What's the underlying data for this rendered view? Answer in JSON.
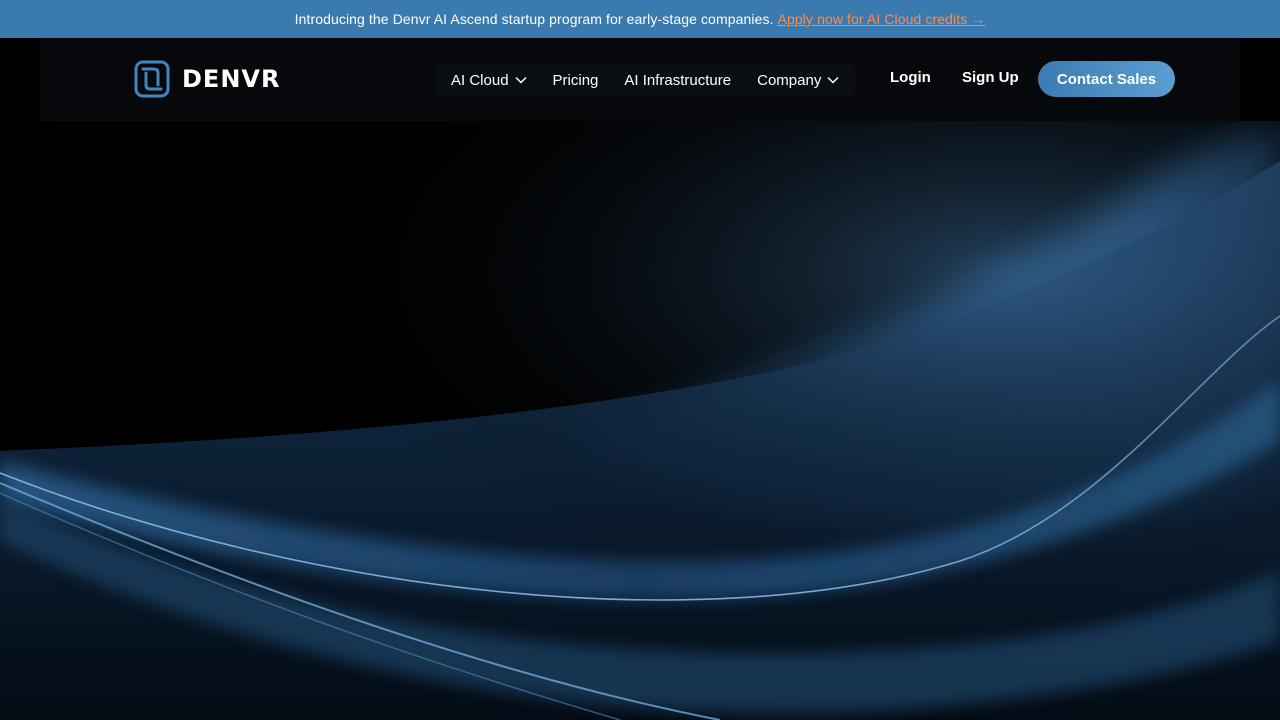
{
  "announcement": {
    "text": "Introducing the Denvr AI Ascend startup program for early-stage companies.",
    "link_label": "Apply now for AI Cloud credits →"
  },
  "brand": {
    "name": "DENVR"
  },
  "nav": {
    "items": [
      {
        "label": "AI Cloud",
        "has_dropdown": true
      },
      {
        "label": "Pricing",
        "has_dropdown": false
      },
      {
        "label": "AI Infrastructure",
        "has_dropdown": false
      },
      {
        "label": "Company",
        "has_dropdown": true
      }
    ]
  },
  "auth": {
    "login_label": "Login",
    "signup_label": "Sign Up"
  },
  "cta": {
    "contact_label": "Contact Sales"
  },
  "colors": {
    "announcement_bg": "#3a7aae",
    "link": "#ff8a4c",
    "brand_blue": "#3b7bb2",
    "background": "#000000"
  }
}
